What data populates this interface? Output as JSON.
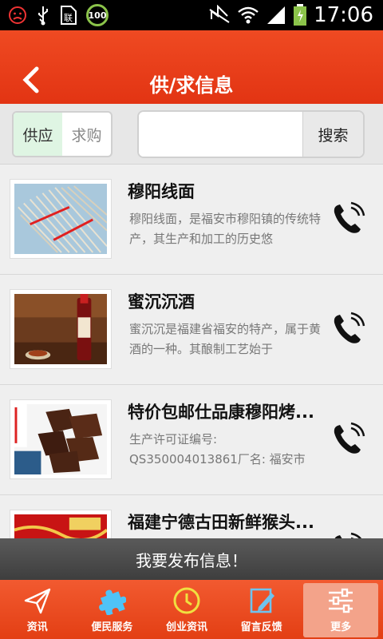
{
  "status_bar": {
    "time": "17:06",
    "battery_badge": "100"
  },
  "header": {
    "title": "供/求信息",
    "back_icon": "chevron-left-icon"
  },
  "filter": {
    "tabs": [
      {
        "label": "供应",
        "selected": true
      },
      {
        "label": "求购",
        "selected": false
      }
    ],
    "search_value": "",
    "search_button": "搜索"
  },
  "items": [
    {
      "title": "穆阳线面",
      "desc": "穆阳线面，是福安市穆阳镇的传统特产，其生产和加工的历史悠"
    },
    {
      "title": "蜜沉沉酒",
      "desc": "蜜沉沉是福建省福安的特产，属于黄酒的一种。其酿制工艺始于"
    },
    {
      "title": "特价包邮仕品康穆阳烤...",
      "desc": "生产许可证编号: QS350004013861厂名: 福安市"
    },
    {
      "title": "福建宁德古田新鲜猴头...",
      "desc": ""
    }
  ],
  "publish_label": "我要发布信息！",
  "nav": [
    {
      "label": "资讯",
      "icon": "paper-plane-icon"
    },
    {
      "label": "便民服务",
      "icon": "puzzle-icon"
    },
    {
      "label": "创业资讯",
      "icon": "clock-icon"
    },
    {
      "label": "留言反馈",
      "icon": "edit-icon"
    },
    {
      "label": "更多",
      "icon": "sliders-icon",
      "active": true
    }
  ],
  "colors": {
    "header": "#e23413",
    "nav": "#e33f14",
    "selected_tab": "#dff5e3"
  }
}
